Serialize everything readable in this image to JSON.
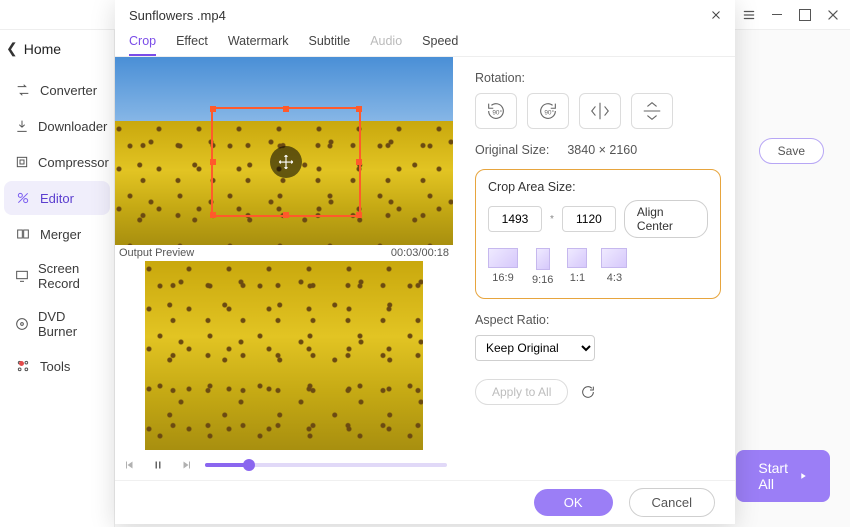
{
  "main_window": {
    "menu_icon": "menu-icon",
    "minimize": "minimize-icon",
    "maximize": "maximize-icon",
    "close": "close-icon"
  },
  "sidebar": {
    "back_label": "Home",
    "items": [
      {
        "label": "Converter",
        "icon": "converter-icon"
      },
      {
        "label": "Downloader",
        "icon": "downloader-icon"
      },
      {
        "label": "Compressor",
        "icon": "compressor-icon"
      },
      {
        "label": "Editor",
        "icon": "editor-icon"
      },
      {
        "label": "Merger",
        "icon": "merger-icon"
      },
      {
        "label": "Screen Record",
        "icon": "screen-recorder-icon"
      },
      {
        "label": "DVD Burner",
        "icon": "dvd-burner-icon"
      },
      {
        "label": "Tools",
        "icon": "tools-icon"
      }
    ]
  },
  "right_pane": {
    "save": "Save",
    "start_all": "Start All"
  },
  "dialog": {
    "title": "Sunflowers .mp4",
    "tabs": [
      "Crop",
      "Effect",
      "Watermark",
      "Subtitle",
      "Audio",
      "Speed"
    ],
    "active_tab": "Crop",
    "disabled_tab": "Audio",
    "preview_label": "Output Preview",
    "time_display": "00:03/00:18",
    "rotation_label": "Rotation:",
    "rotation_buttons": [
      "rotate-ccw-90",
      "rotate-cw-90",
      "flip-horizontal",
      "flip-vertical"
    ],
    "original_size_label": "Original Size:",
    "original_size_value": "3840 × 2160",
    "crop_area_label": "Crop Area Size:",
    "crop_width": "1493",
    "crop_height": "1120",
    "align_center": "Align Center",
    "ratios": [
      {
        "label": "16:9",
        "kind": "r169"
      },
      {
        "label": "9:16",
        "kind": "r916"
      },
      {
        "label": "1:1",
        "kind": "r11"
      },
      {
        "label": "4:3",
        "kind": "r43"
      }
    ],
    "aspect_label": "Aspect Ratio:",
    "aspect_value": "Keep Original",
    "apply_all": "Apply to All",
    "ok": "OK",
    "cancel": "Cancel"
  }
}
